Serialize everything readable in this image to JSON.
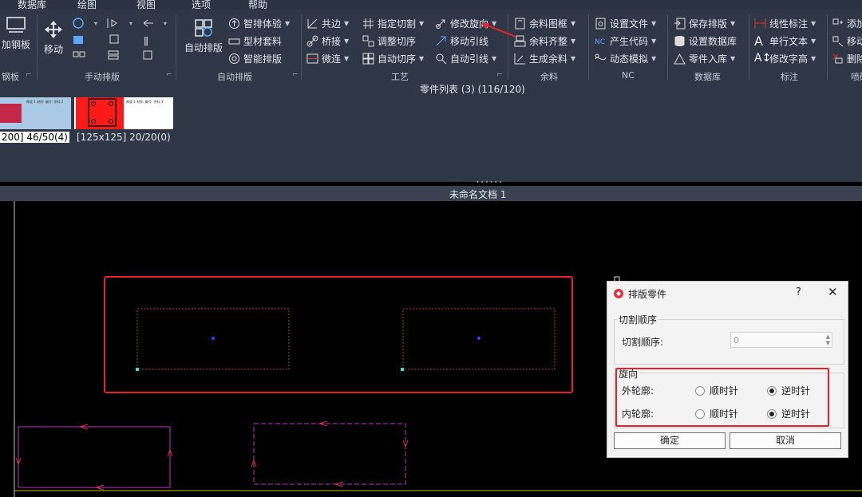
{
  "menubar": [
    "数据库",
    "绘图",
    "视图",
    "选项",
    "帮助"
  ],
  "ribbon": {
    "steel": {
      "big_label": "加钢板",
      "group": "钢板"
    },
    "manual": {
      "big_label": "移动",
      "group": "手动排版"
    },
    "auto": {
      "big_label": "自动排版",
      "items": [
        "智排体验",
        "型材套料",
        "智能排版"
      ],
      "group": "自动排版"
    },
    "craft": {
      "items": [
        "共边",
        "指定切割",
        "修改旋向",
        "桥接",
        "调整切序",
        "移动引线",
        "微连",
        "自动切序",
        "自动引线"
      ],
      "group": "工艺"
    },
    "remnant": {
      "items": [
        "余料图框",
        "余料齐整",
        "生成余料"
      ],
      "group": "余料"
    },
    "nc": {
      "items": [
        "设置文件",
        "产生代码",
        "动态模拟"
      ],
      "group": "NC"
    },
    "database": {
      "items": [
        "保存排版",
        "设置数据库",
        "零件入库"
      ],
      "group": "数据库"
    },
    "annotate": {
      "items": [
        "线性标注",
        "单行文本",
        "修改字高"
      ],
      "group": "标注"
    },
    "spray": {
      "items": [
        "添加",
        "移动",
        "删除"
      ],
      "group": "喷码"
    }
  },
  "parts_list": {
    "title": "零件列表 (3) (116/120)",
    "parts": [
      {
        "caption": "200] 46/50(4)",
        "info": "厚度:1 材质: 编号: 余料:2",
        "selected": true
      },
      {
        "caption": "[125x125] 20/20(0)",
        "info": "厚度:1 材质: 编号: 余料:3",
        "selected": false
      }
    ]
  },
  "document": {
    "title": "未命名文档 1"
  },
  "dialog": {
    "title": "排版零件",
    "help": "?",
    "close": "✕",
    "cut_order": {
      "legend": "切割顺序",
      "label": "切割顺序:",
      "value": "0"
    },
    "direction": {
      "legend": "旋向",
      "outer_label": "外轮廓:",
      "inner_label": "内轮廓:",
      "cw": "顺时针",
      "ccw": "逆时针",
      "outer_selected": "逆时针",
      "inner_selected": "逆时针"
    },
    "ok": "确定",
    "cancel": "取消"
  },
  "colors": {
    "highlight": "#e8212b",
    "part_outline": "#c8362a",
    "magenta": "#c032c8",
    "ribbon_bg": "#2f3645"
  }
}
